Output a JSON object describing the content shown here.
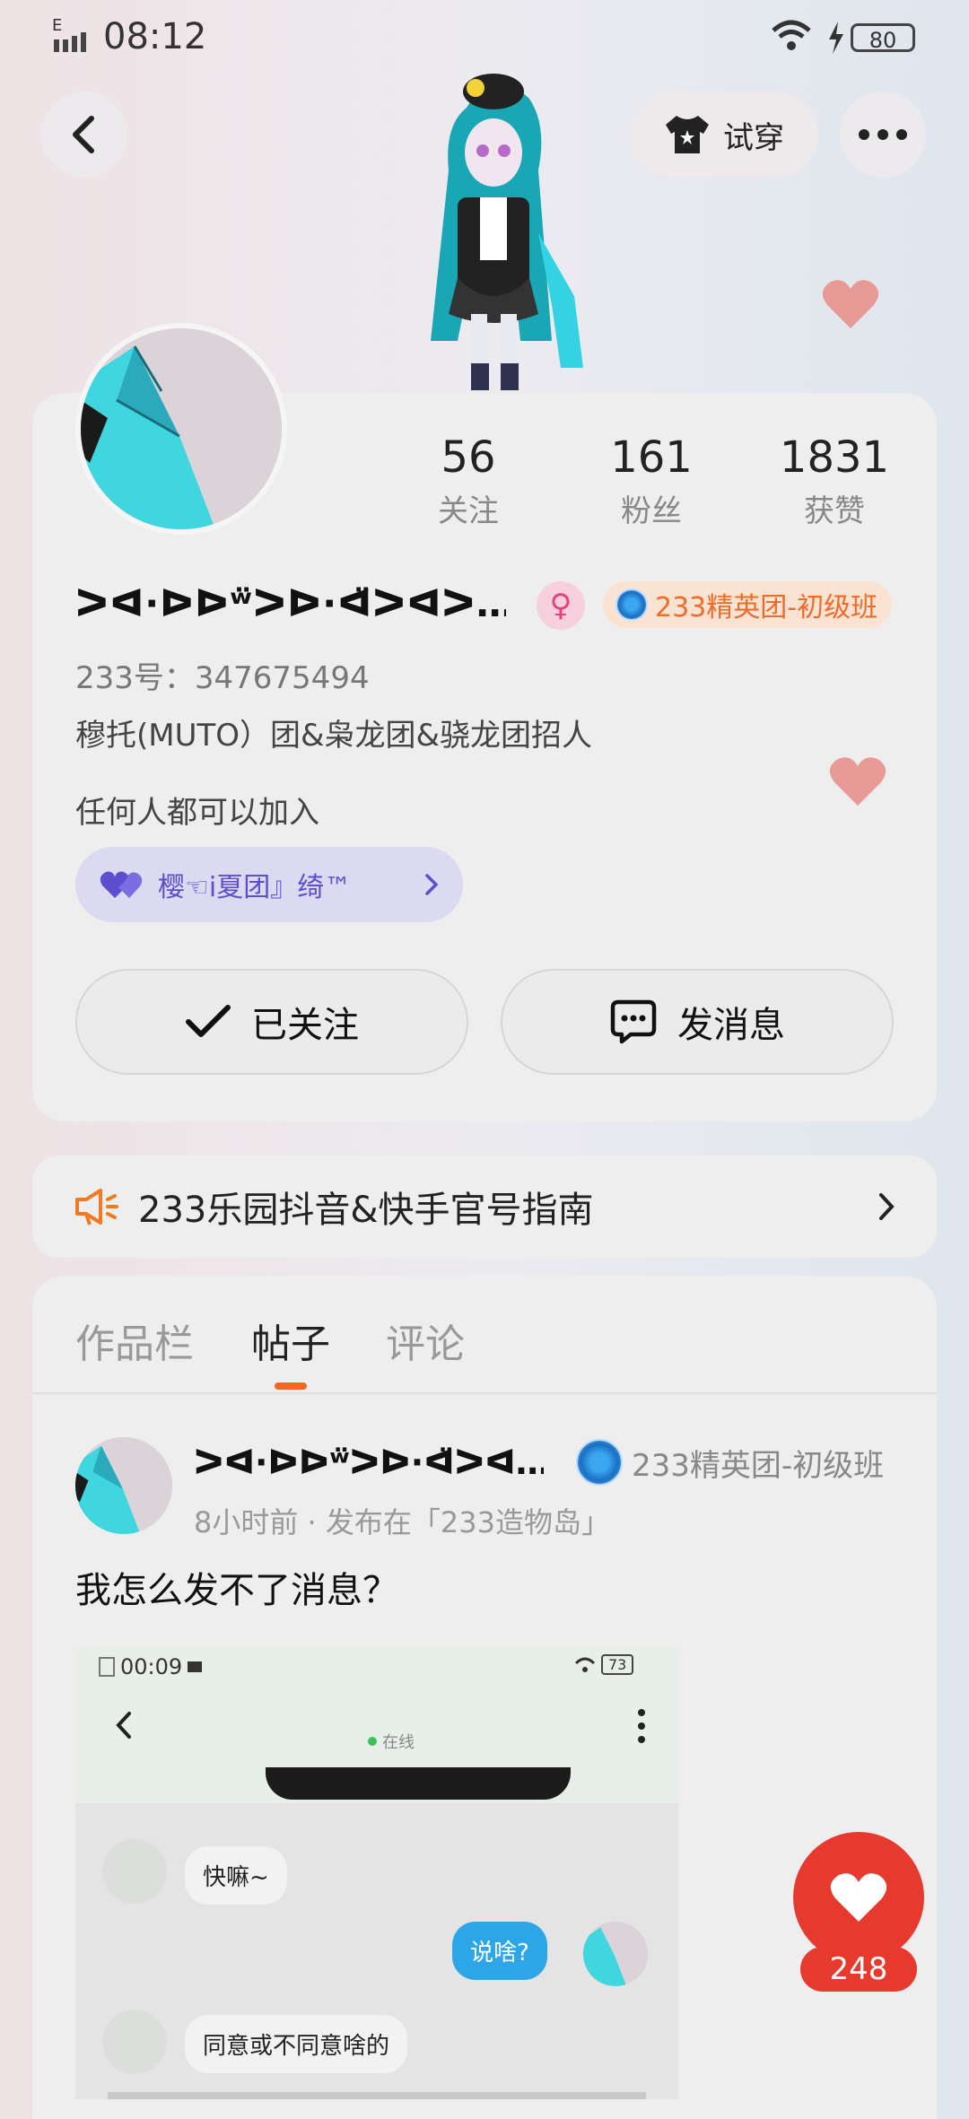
{
  "status_bar": {
    "signal_label": "E",
    "time": "08:12",
    "battery": "80"
  },
  "header": {
    "tryon_label": "试穿"
  },
  "profile": {
    "stats": [
      {
        "value": "56",
        "label": "关注"
      },
      {
        "value": "161",
        "label": "粉丝"
      },
      {
        "value": "1831",
        "label": "获赞"
      }
    ],
    "nickname": "ᐳᐊ·ᐅᐅʷ̈ᐳᐅ·ᐊ̈ᐳᐊᐳ…",
    "gender_symbol": "♀",
    "badge_label": "233精英团-初级班",
    "uid": "233号：347675494",
    "bio_line1": "穆托(MUTO）团&枭龙团&骁龙团招人",
    "bio_line2": "任何人都可以加入",
    "group_name": "樱☜i夏团』绮™",
    "follow_label": "已关注",
    "message_label": "发消息"
  },
  "notice": {
    "text": "233乐园抖音&快手官号指南"
  },
  "tabs": [
    {
      "label": "作品栏",
      "active": false
    },
    {
      "label": "帖子",
      "active": true
    },
    {
      "label": "评论",
      "active": false
    }
  ],
  "post": {
    "author": "ᐳᐊ·ᐅᐅʷ̈ᐳᐅ·ᐊ̈ᐳᐊ…",
    "badge_label": "233精英团-初级班",
    "meta": "8小时前 · 发布在「233造物岛」",
    "text": "我怎么发不了消息？",
    "screenshot": {
      "time": "00:09",
      "battery": "73",
      "online": "在线",
      "messages": [
        {
          "side": "left",
          "text": "快嘛~"
        },
        {
          "side": "right",
          "text": "说啥?"
        },
        {
          "side": "left",
          "text": "同意或不同意啥的"
        }
      ]
    }
  },
  "like": {
    "count": "248"
  },
  "colors": {
    "accent_orange": "#f06a22",
    "like_red": "#e63a2f",
    "group_purple": "#5b4fd0"
  }
}
